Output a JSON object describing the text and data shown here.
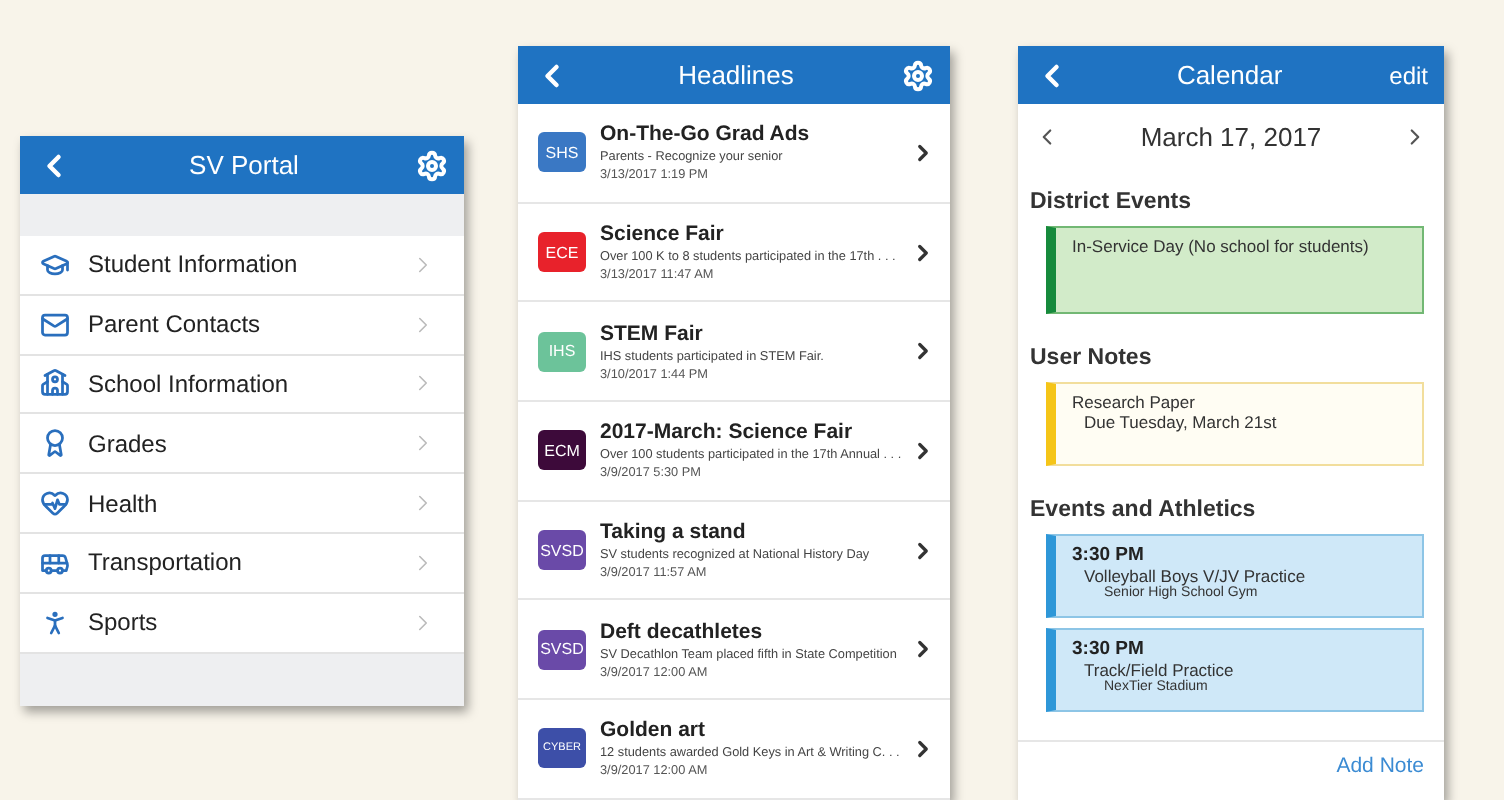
{
  "portal": {
    "title": "SV Portal",
    "items": [
      {
        "label": "Student Information"
      },
      {
        "label": "Parent Contacts"
      },
      {
        "label": "School Information"
      },
      {
        "label": "Grades"
      },
      {
        "label": "Health"
      },
      {
        "label": "Transportation"
      },
      {
        "label": "Sports"
      }
    ]
  },
  "headlines": {
    "title": "Headlines",
    "items": [
      {
        "badge": "SHS",
        "color": "#3a78c4",
        "title": "On-The-Go Grad Ads",
        "summary": "Parents - Recognize your senior",
        "date": "3/13/2017 1:19 PM"
      },
      {
        "badge": "ECE",
        "color": "#e8222b",
        "title": "Science Fair",
        "summary": "Over 100 K to 8 students participated in the 17th . . .",
        "date": "3/13/2017 11:47 AM"
      },
      {
        "badge": "IHS",
        "color": "#6cc39a",
        "title": "STEM Fair",
        "summary": "IHS students participated in STEM Fair.",
        "date": "3/10/2017 1:44 PM"
      },
      {
        "badge": "ECM",
        "color": "#3d0a3a",
        "title": "2017-March: Science Fair",
        "summary": "Over 100 students participated in the 17th Annual . . .",
        "date": "3/9/2017 5:30 PM"
      },
      {
        "badge": "SVSD",
        "color": "#6a4aa8",
        "title": "Taking a stand",
        "summary": "SV students recognized at National History Day",
        "date": "3/9/2017 11:57 AM"
      },
      {
        "badge": "SVSD",
        "color": "#6a4aa8",
        "title": "Deft decathletes",
        "summary": "SV Decathlon Team placed fifth in State Competition",
        "date": "3/9/2017 12:00 AM"
      },
      {
        "badge": "CYBER",
        "color": "#3d4fa8",
        "title": "Golden art",
        "summary": "12 students awarded Gold Keys in Art & Writing C. . .",
        "date": "3/9/2017 12:00 AM"
      }
    ]
  },
  "calendar": {
    "title": "Calendar",
    "action": "edit",
    "date": "March 17, 2017",
    "sections": [
      {
        "heading": "District Events",
        "kind": "district",
        "entries": [
          {
            "lines": [
              "In-Service Day (No school for students)"
            ]
          }
        ]
      },
      {
        "heading": "User Notes",
        "kind": "note",
        "entries": [
          {
            "lines": [
              "Research Paper",
              "Due Tuesday, March 21st"
            ]
          }
        ]
      },
      {
        "heading": "Events and Athletics",
        "kind": "event",
        "entries": [
          {
            "time": "3:30 PM",
            "lines": [
              "Volleyball Boys V/JV Practice",
              "Senior High School Gym"
            ]
          },
          {
            "time": "3:30 PM",
            "lines": [
              "Track/Field Practice",
              "NexTier Stadium"
            ]
          }
        ]
      }
    ],
    "footer": "Add Note"
  }
}
